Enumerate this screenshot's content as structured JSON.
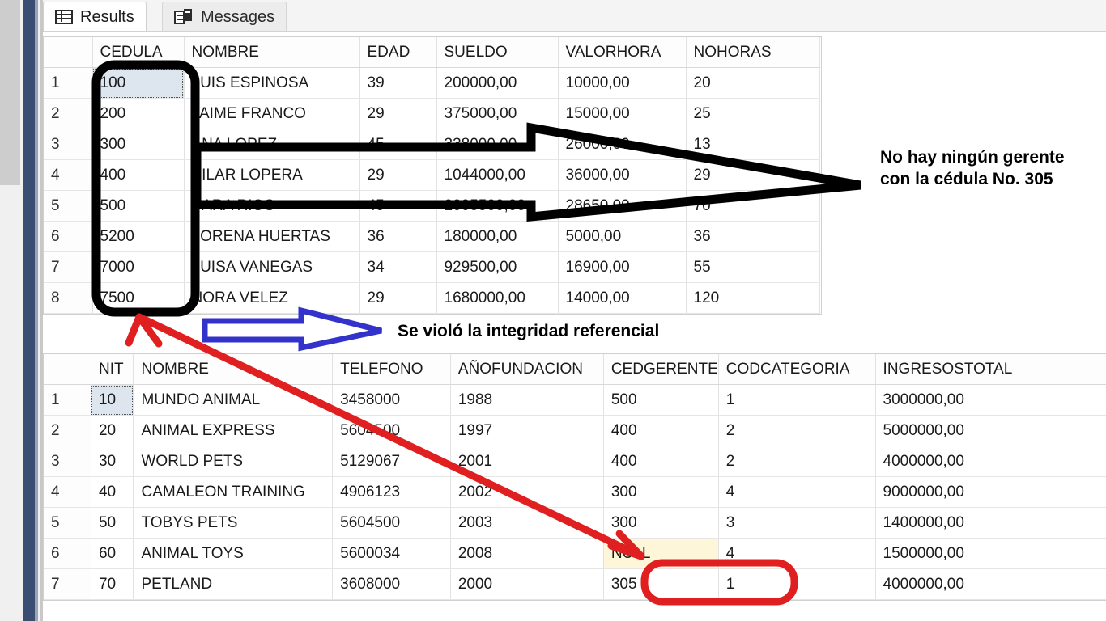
{
  "tabs": [
    {
      "label": "Results",
      "icon": "grid-icon",
      "active": true
    },
    {
      "label": "Messages",
      "icon": "messages-icon",
      "active": false
    }
  ],
  "grids": [
    {
      "name": "empleados",
      "columns": [
        "",
        "CEDULA",
        "NOMBRE",
        "EDAD",
        "SUELDO",
        "VALORHORA",
        "NOHORAS"
      ],
      "rows": [
        [
          "1",
          "100",
          "LUIS ESPINOSA",
          "39",
          "200000,00",
          "10000,00",
          "20"
        ],
        [
          "2",
          "200",
          "JAIME FRANCO",
          "29",
          "375000,00",
          "15000,00",
          "25"
        ],
        [
          "3",
          "300",
          "ANA LOPEZ",
          "45",
          "338000,00",
          "26000,00",
          "13"
        ],
        [
          "4",
          "400",
          "PILAR LOPERA",
          "29",
          "1044000,00",
          "36000,00",
          "29"
        ],
        [
          "5",
          "500",
          "SARA RIOS",
          "45",
          "2005500,00",
          "28650,00",
          "70"
        ],
        [
          "6",
          "5200",
          "LORENA HUERTAS",
          "36",
          "180000,00",
          "5000,00",
          "36"
        ],
        [
          "7",
          "7000",
          "LUISA VANEGAS",
          "34",
          "929500,00",
          "16900,00",
          "55"
        ],
        [
          "8",
          "7500",
          "NORA VELEZ",
          "29",
          "1680000,00",
          "14000,00",
          "120"
        ]
      ],
      "selected_cell": {
        "row": 0,
        "col": 1
      }
    },
    {
      "name": "empresas",
      "columns": [
        "",
        "NIT",
        "NOMBRE",
        "TELEFONO",
        "AÑOFUNDACION",
        "CEDGERENTE",
        "CODCATEGORIA",
        "INGRESOSTOTAL"
      ],
      "rows": [
        [
          "1",
          "10",
          "MUNDO ANIMAL",
          "3458000",
          "1988",
          "500",
          "1",
          "3000000,00"
        ],
        [
          "2",
          "20",
          "ANIMAL EXPRESS",
          "5604500",
          "1997",
          "400",
          "2",
          "5000000,00"
        ],
        [
          "3",
          "30",
          "WORLD PETS",
          "5129067",
          "2001",
          "400",
          "2",
          "4000000,00"
        ],
        [
          "4",
          "40",
          "CAMALEON TRAINING",
          "4906123",
          "2002",
          "300",
          "4",
          "9000000,00"
        ],
        [
          "5",
          "50",
          "TOBYS PETS",
          "5604500",
          "2003",
          "300",
          "3",
          "1400000,00"
        ],
        [
          "6",
          "60",
          "ANIMAL TOYS",
          "5600034",
          "2008",
          "NULL",
          "4",
          "1500000,00"
        ],
        [
          "7",
          "70",
          "PETLAND",
          "3608000",
          "2000",
          "305",
          "1",
          "4000000,00"
        ]
      ],
      "selected_cell": {
        "row": 0,
        "col": 1
      },
      "null_cell": {
        "row": 5,
        "col": 5
      }
    }
  ],
  "annotations": {
    "no_gerente": "No hay ningún gerente con la cédula No. 305",
    "integridad": "Se violó la integridad referencial",
    "colors": {
      "black_arrow": "#000000",
      "blue_arrow": "#3333cc",
      "red_arrow": "#e02020",
      "highlight_box": "#000000",
      "red_circle": "#e02020",
      "accent_bar": "#3a4e73",
      "null_highlight": "#fdf6d8",
      "selection": "#dde5ef"
    }
  }
}
